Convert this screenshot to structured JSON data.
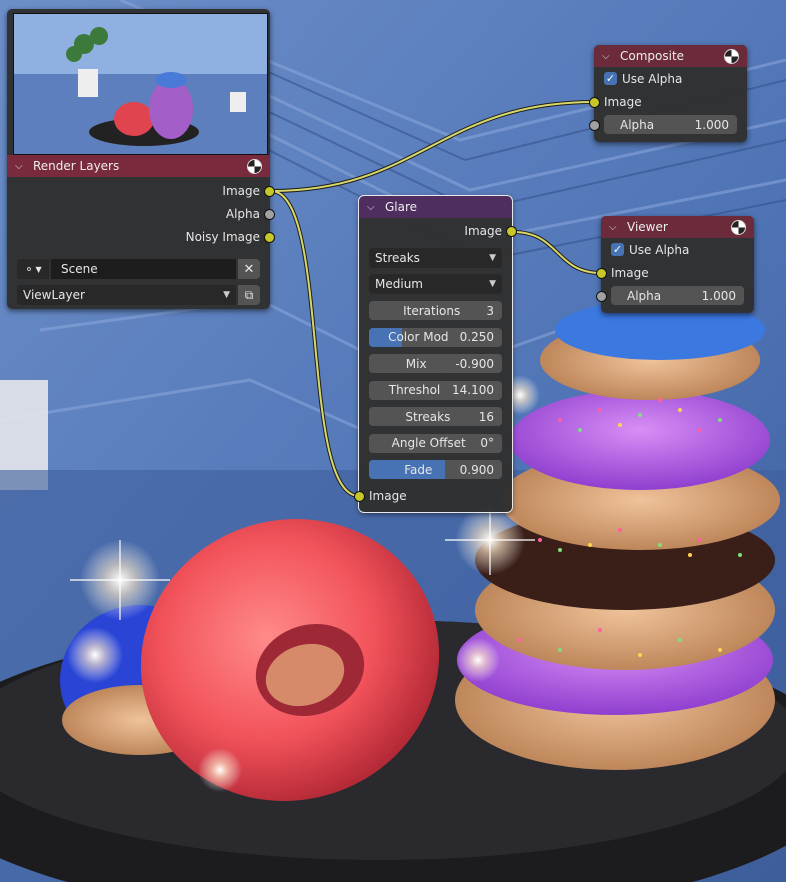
{
  "nodes": {
    "render_layers": {
      "title": "Render Layers",
      "outputs": [
        "Image",
        "Alpha",
        "Noisy Image"
      ],
      "scene": "Scene",
      "view_layer": "ViewLayer"
    },
    "composite": {
      "title": "Composite",
      "use_alpha_label": "Use Alpha",
      "use_alpha": true,
      "input_label": "Image",
      "alpha_label": "Alpha",
      "alpha_value": "1.000"
    },
    "glare": {
      "title": "Glare",
      "output_label": "Image",
      "glare_type": "Streaks",
      "quality": "Medium",
      "fields": [
        {
          "label": "Iterations",
          "value": "3",
          "fill": 0
        },
        {
          "label": "Color Mod",
          "value": "0.250",
          "fill": 0.25
        },
        {
          "label": "Mix",
          "value": "-0.900",
          "fill": 0
        },
        {
          "label": "Threshol",
          "value": "14.100",
          "fill": 0
        },
        {
          "label": "Streaks",
          "value": "16",
          "fill": 0
        },
        {
          "label": "Angle Offset",
          "value": "0°",
          "fill": 0
        },
        {
          "label": "Fade",
          "value": "0.900",
          "fill": 0.575
        }
      ],
      "input_label": "Image"
    },
    "viewer": {
      "title": "Viewer",
      "use_alpha_label": "Use Alpha",
      "use_alpha": true,
      "input_label": "Image",
      "alpha_label": "Alpha",
      "alpha_value": "1.000"
    }
  },
  "colors": {
    "socket_color": "#c7c729",
    "link_color": "#d8d86a",
    "accent": "#4772b3"
  },
  "icons": {
    "node_preview": "render-preview-thumbnail",
    "scene": "scene-icon",
    "view_layer": "view-layer-icon"
  }
}
